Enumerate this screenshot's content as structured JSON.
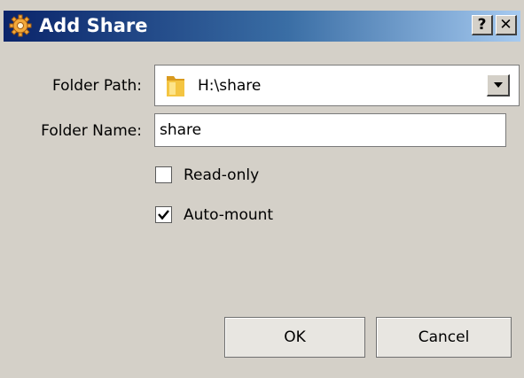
{
  "window": {
    "title": "Add Share",
    "help_label": "?",
    "close_label": "✕"
  },
  "form": {
    "folder_path_label": "Folder Path:",
    "folder_path_value": "H:\\share",
    "folder_name_label": "Folder Name:",
    "folder_name_value": "share"
  },
  "options": {
    "read_only_label": "Read-only",
    "read_only_checked": false,
    "auto_mount_label": "Auto-mount",
    "auto_mount_checked": true
  },
  "buttons": {
    "ok_label": "OK",
    "cancel_label": "Cancel"
  },
  "icons": {
    "title_icon": "gear-icon",
    "folder_icon": "folder-icon",
    "dropdown_icon": "chevron-down-icon",
    "check_icon": "checkmark-icon"
  },
  "colors": {
    "titlebar_start": "#0a246a",
    "titlebar_end": "#a6caf0",
    "dialog_bg": "#d4d0c8"
  }
}
